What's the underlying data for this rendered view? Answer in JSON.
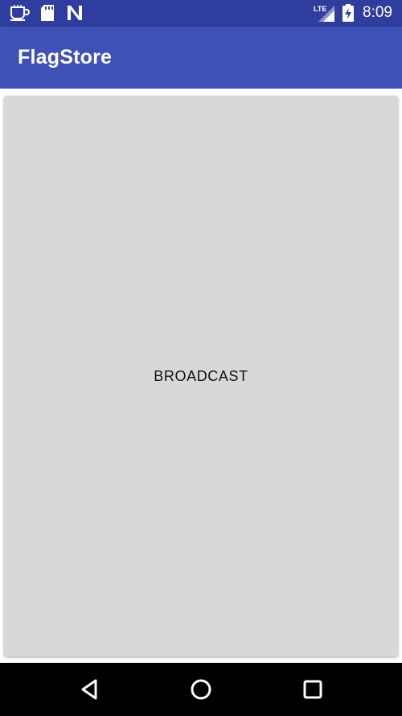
{
  "status_bar": {
    "time": "8:09",
    "icons": [
      "coffee-notification-icon",
      "sd-card-icon",
      "n-notification-icon",
      "lte-signal-icon",
      "battery-charging-icon"
    ],
    "network_label": "LTE"
  },
  "app_bar": {
    "title": "FlagStore"
  },
  "main": {
    "button_label": "BROADCAST"
  },
  "nav_bar": {
    "buttons": [
      "back",
      "home",
      "recents"
    ]
  },
  "colors": {
    "status_bar": "#2f3e9e",
    "app_bar": "#3f51b5",
    "button_bg": "#d7d9d8",
    "nav_bar": "#000000"
  }
}
